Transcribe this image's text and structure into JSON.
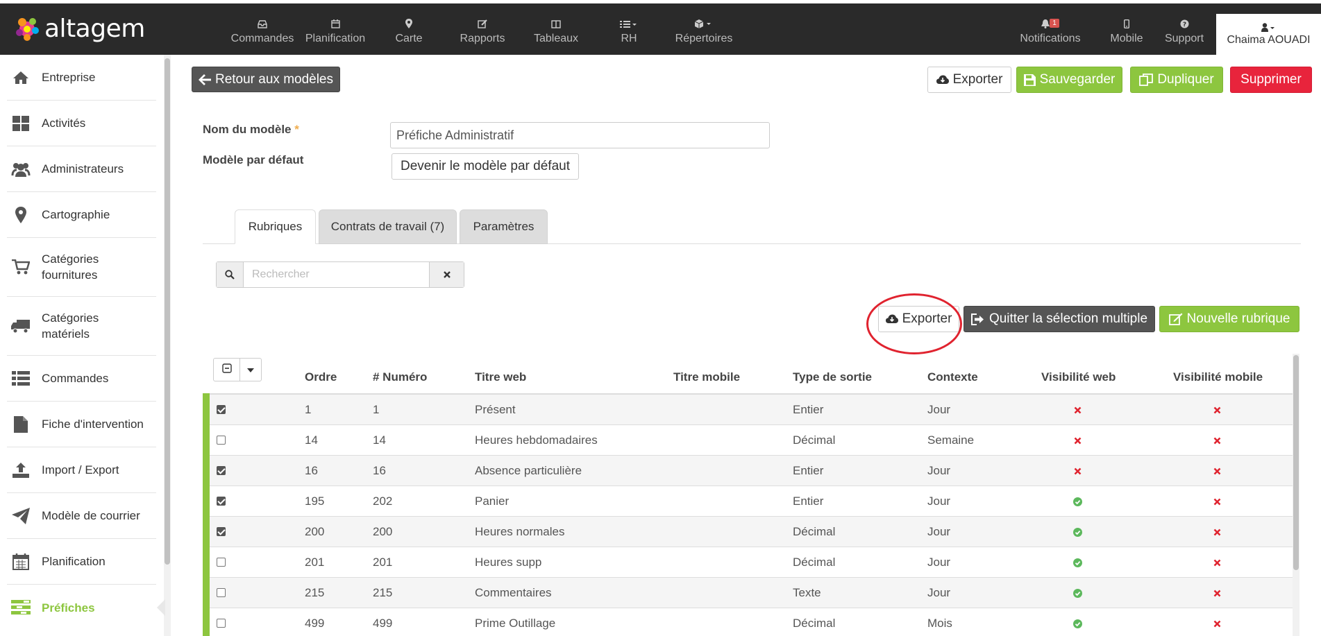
{
  "app": {
    "brand": "altagem"
  },
  "nav": {
    "items": [
      {
        "label": "Commandes",
        "icon": "inbox-icon"
      },
      {
        "label": "Planification",
        "icon": "calendar-icon"
      },
      {
        "label": "Carte",
        "icon": "map-marker-icon"
      },
      {
        "label": "Rapports",
        "icon": "edit-icon"
      },
      {
        "label": "Tableaux",
        "icon": "columns-icon"
      },
      {
        "label": "RH",
        "icon": "list-icon"
      },
      {
        "label": "Répertoires",
        "icon": "cube-icon"
      }
    ],
    "right": [
      {
        "label": "Notifications",
        "icon": "bell-icon",
        "badge": "1"
      },
      {
        "label": "Mobile",
        "icon": "mobile-icon"
      },
      {
        "label": "Support",
        "icon": "question-icon"
      }
    ],
    "user": "Chaima AOUADI"
  },
  "sidebar": {
    "items": [
      {
        "label": "Entreprise",
        "icon": "home-icon"
      },
      {
        "label": "Activités",
        "icon": "dashboard-icon"
      },
      {
        "label": "Administrateurs",
        "icon": "users-icon"
      },
      {
        "label": "Cartographie",
        "icon": "map-marker-icon"
      },
      {
        "label": "Catégories fournitures",
        "icon": "cart-icon"
      },
      {
        "label": "Catégories matériels",
        "icon": "truck-icon"
      },
      {
        "label": "Commandes",
        "icon": "list-icon"
      },
      {
        "label": "Fiche d'intervention",
        "icon": "file-icon"
      },
      {
        "label": "Import / Export",
        "icon": "upload-icon"
      },
      {
        "label": "Modèle de courrier",
        "icon": "send-icon"
      },
      {
        "label": "Planification",
        "icon": "calendar-icon"
      },
      {
        "label": "Préfiches",
        "icon": "tasks-icon",
        "active": true
      }
    ]
  },
  "toolbar": {
    "back": "Retour aux modèles",
    "export": "Exporter",
    "save": "Sauvegarder",
    "duplicate": "Dupliquer",
    "delete": "Supprimer"
  },
  "form": {
    "name_label": "Nom du modèle",
    "required_mark": "*",
    "name_value": "Préfiche Administratif",
    "default_label": "Modèle par défaut",
    "default_button": "Devenir le modèle par défaut"
  },
  "tabs": [
    {
      "label": "Rubriques",
      "active": true
    },
    {
      "label": "Contrats de travail (7)"
    },
    {
      "label": "Paramètres"
    }
  ],
  "search": {
    "placeholder": "Rechercher",
    "value": ""
  },
  "actions": {
    "export": "Exporter",
    "quit_multi": "Quitter la sélection multiple",
    "new_rubric": "Nouvelle rubrique"
  },
  "table": {
    "headers": [
      "Ordre",
      "# Numéro",
      "Titre web",
      "Titre mobile",
      "Type de sortie",
      "Contexte",
      "Visibilité web",
      "Visibilité mobile"
    ],
    "rows": [
      {
        "checked": true,
        "ordre": "1",
        "numero": "1",
        "titre_web": "Présent",
        "titre_mobile": "",
        "type": "Entier",
        "contexte": "Jour",
        "vis_web": false,
        "vis_mobile": false
      },
      {
        "checked": false,
        "ordre": "14",
        "numero": "14",
        "titre_web": "Heures hebdomadaires",
        "titre_mobile": "",
        "type": "Décimal",
        "contexte": "Semaine",
        "vis_web": false,
        "vis_mobile": false
      },
      {
        "checked": true,
        "ordre": "16",
        "numero": "16",
        "titre_web": "Absence particulière",
        "titre_mobile": "",
        "type": "Entier",
        "contexte": "Jour",
        "vis_web": false,
        "vis_mobile": false
      },
      {
        "checked": true,
        "ordre": "195",
        "numero": "202",
        "titre_web": "Panier",
        "titre_mobile": "",
        "type": "Entier",
        "contexte": "Jour",
        "vis_web": true,
        "vis_mobile": false
      },
      {
        "checked": true,
        "ordre": "200",
        "numero": "200",
        "titre_web": "Heures normales",
        "titre_mobile": "",
        "type": "Décimal",
        "contexte": "Jour",
        "vis_web": true,
        "vis_mobile": false
      },
      {
        "checked": false,
        "ordre": "201",
        "numero": "201",
        "titre_web": "Heures supp",
        "titre_mobile": "",
        "type": "Décimal",
        "contexte": "Jour",
        "vis_web": true,
        "vis_mobile": false
      },
      {
        "checked": false,
        "ordre": "215",
        "numero": "215",
        "titre_web": "Commentaires",
        "titre_mobile": "",
        "type": "Texte",
        "contexte": "Jour",
        "vis_web": true,
        "vis_mobile": false
      },
      {
        "checked": false,
        "ordre": "499",
        "numero": "499",
        "titre_web": "Prime Outillage",
        "titre_mobile": "",
        "type": "Décimal",
        "contexte": "Mois",
        "vis_web": true,
        "vis_mobile": false
      }
    ]
  },
  "colors": {
    "navbar": "#2a2a2a",
    "accent_green": "#8dc63f",
    "danger_red": "#e8243c",
    "check_green": "#5cb85c",
    "cross_red": "#e0232f"
  }
}
